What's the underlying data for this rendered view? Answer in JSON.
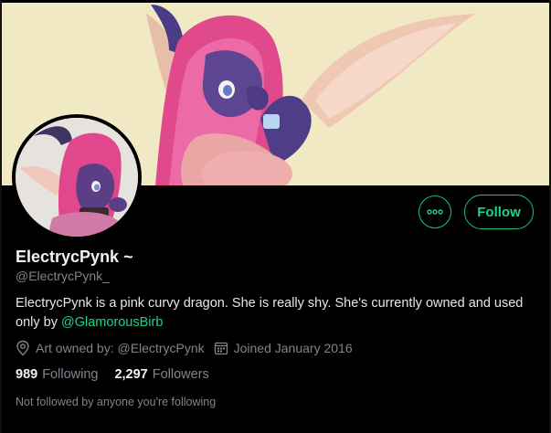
{
  "profile": {
    "display_name": "ElectrycPynk ~",
    "handle": "@ElectrycPynk_",
    "bio_text": "ElectrycPynk is a pink curvy dragon. She is really shy. She's currently owned and used only by ",
    "bio_mention": "@GlamorousBirb",
    "location": "Art owned by: @ElectrycPynk",
    "joined": "Joined January 2016",
    "following_count": "989",
    "following_label": "Following",
    "followers_count": "2,297",
    "followers_label": "Followers",
    "not_followed_note": "Not followed by anyone you're following"
  },
  "actions": {
    "follow_label": "Follow",
    "more_icon": "more-icon"
  },
  "colors": {
    "accent": "#1fd386",
    "background": "#000000",
    "banner_bg": "#f1ebc6",
    "hair_pink": "#e2488d",
    "skin_purple": "#5a3f86"
  }
}
